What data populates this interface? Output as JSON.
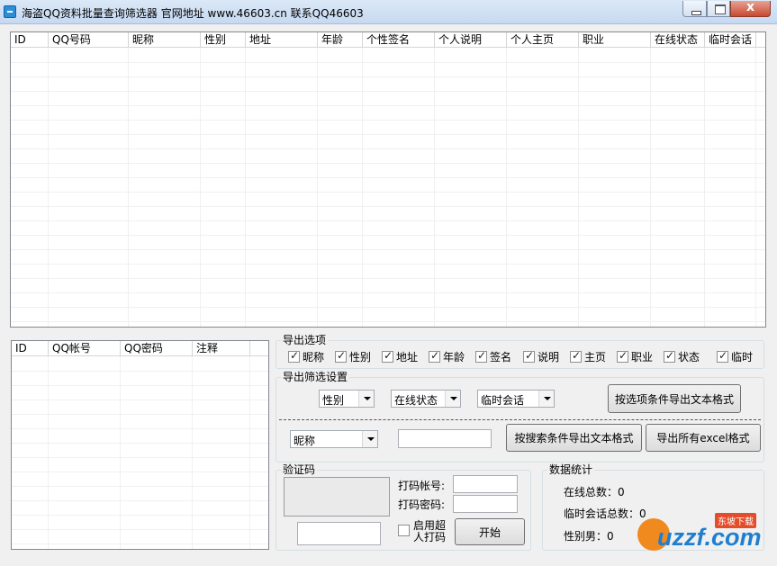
{
  "window": {
    "title": "海盗QQ资料批量查询筛选器 官网地址 www.46603.cn 联系QQ46603",
    "close_glyph": "x"
  },
  "result_table": {
    "columns": [
      "ID",
      "QQ号码",
      "昵称",
      "性别",
      "地址",
      "年龄",
      "个性签名",
      "个人说明",
      "个人主页",
      "职业",
      "在线状态",
      "临时会话"
    ]
  },
  "account_table": {
    "columns": [
      "ID",
      "QQ帐号",
      "QQ密码",
      "注释"
    ]
  },
  "export_options": {
    "title": "导出选项",
    "items": [
      {
        "label": "昵称",
        "checked": true
      },
      {
        "label": "性别",
        "checked": true
      },
      {
        "label": "地址",
        "checked": true
      },
      {
        "label": "年龄",
        "checked": true
      },
      {
        "label": "签名",
        "checked": true
      },
      {
        "label": "说明",
        "checked": true
      },
      {
        "label": "主页",
        "checked": true
      },
      {
        "label": "职业",
        "checked": true
      },
      {
        "label": "状态",
        "checked": true
      },
      {
        "label": "临时",
        "checked": true
      }
    ]
  },
  "filter_settings": {
    "title": "导出筛选设置",
    "gender_select": "性别",
    "status_select": "在线状态",
    "chat_select": "临时会话",
    "export_by_options_button": "按选项条件导出文本格式",
    "field_select": "昵称",
    "search_value": "",
    "export_by_search_button": "按搜索条件导出文本格式",
    "export_all_excel_button": "导出所有excel格式"
  },
  "captcha": {
    "title": "验证码",
    "account_label": "打码帐号:",
    "account_value": "",
    "password_label": "打码密码:",
    "password_value": "",
    "captcha_input": "",
    "super_captcha_label_line1": "启用超",
    "super_captcha_label_line2": "人打码",
    "super_captcha_checked": false,
    "start_button": "开始"
  },
  "stats": {
    "title": "数据统计",
    "online_total": "在线总数：0",
    "temp_chat_total": "临时会话总数：0",
    "gender_male": "性别男：0"
  },
  "watermark": {
    "brand": "uzzf.com",
    "badge": "东坡下载"
  }
}
